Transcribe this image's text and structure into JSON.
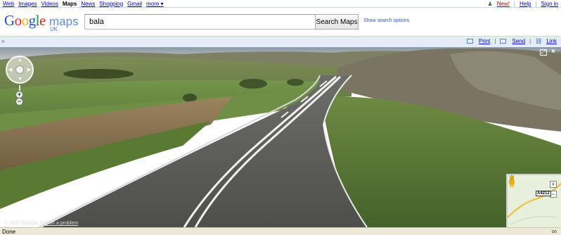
{
  "gbar": {
    "left_links": [
      "Web",
      "Images",
      "Videos",
      "Maps",
      "News",
      "Shopping",
      "Gmail",
      "more ▾"
    ],
    "active_link": "Maps",
    "new_label": "New!",
    "help_label": "Help",
    "signin_label": "Sign in"
  },
  "logo": {
    "brand": "Google",
    "product": "maps",
    "region": "UK"
  },
  "search": {
    "value": "bala",
    "button_label": "Search Maps",
    "options_label": "Show search options"
  },
  "toolbar": {
    "collapse_label": "»",
    "print_label": "Print",
    "send_label": "Send",
    "link_label": "Link",
    "separator": "|"
  },
  "streetview": {
    "copyright": "© 2010 Google",
    "report_label": "Report a problem",
    "road_shield": "A4212",
    "zoom_in": "+",
    "zoom_out": "−"
  },
  "status": {
    "text": "Done"
  },
  "colors": {
    "link": "#0000cc",
    "toolbar_bg": "#e5ecf9",
    "status_bg": "#ece9d8"
  }
}
